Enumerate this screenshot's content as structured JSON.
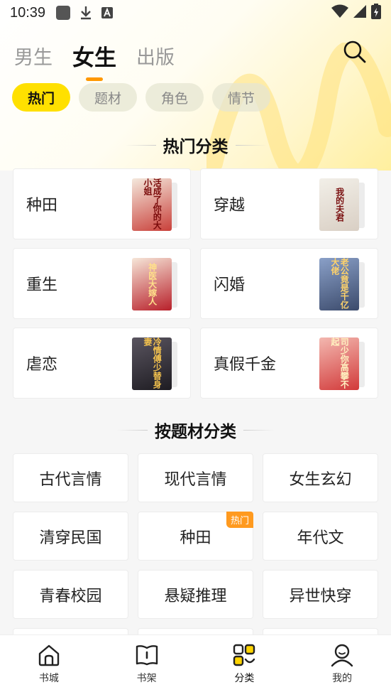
{
  "status_bar": {
    "time": "10:39"
  },
  "top_tabs": [
    {
      "label": "男生"
    },
    {
      "label": "女生",
      "active": true
    },
    {
      "label": "出版"
    }
  ],
  "filter_chips": [
    {
      "label": "热门",
      "active": true
    },
    {
      "label": "题材"
    },
    {
      "label": "角色"
    },
    {
      "label": "情节"
    }
  ],
  "hot_section": {
    "title": "热门分类",
    "cards": [
      {
        "label": "种田",
        "cover_text": "活成了你的大小姐",
        "cover_bg": "#c9403a",
        "cover_fg": "#fff4e0"
      },
      {
        "label": "穿越",
        "cover_text": "我的夫君",
        "cover_bg": "#e8e2da",
        "cover_fg": "#7a1010"
      },
      {
        "label": "重生",
        "cover_text": "神医大嫁人",
        "cover_bg": "#b8202a",
        "cover_fg": "#ffe08a"
      },
      {
        "label": "闪婚",
        "cover_text": "老公竟是千亿大佬",
        "cover_bg": "#3b4a6b",
        "cover_fg": "#ffd36a"
      },
      {
        "label": "虐恋",
        "cover_text": "冷情傅少替身妻",
        "cover_bg": "#2c2a30",
        "cover_fg": "#f2c14e"
      },
      {
        "label": "真假千金",
        "cover_text": "司少你高攀不起",
        "cover_bg": "#d23a3a",
        "cover_fg": "#fff1c0"
      }
    ]
  },
  "genre_section": {
    "title": "按题材分类",
    "items": [
      {
        "label": "古代言情"
      },
      {
        "label": "现代言情"
      },
      {
        "label": "女生玄幻"
      },
      {
        "label": "清穿民国"
      },
      {
        "label": "种田",
        "badge": "热门"
      },
      {
        "label": "年代文"
      },
      {
        "label": "青春校园"
      },
      {
        "label": "悬疑推理"
      },
      {
        "label": "异世快穿"
      }
    ]
  },
  "bottom_nav": [
    {
      "label": "书城",
      "icon": "home-icon"
    },
    {
      "label": "书架",
      "icon": "bookshelf-icon"
    },
    {
      "label": "分类",
      "icon": "category-icon",
      "active": true
    },
    {
      "label": "我的",
      "icon": "profile-icon"
    }
  ],
  "colors": {
    "accent": "#ffe000",
    "indicator": "#ff9800",
    "badge": "#ff9a1f"
  }
}
